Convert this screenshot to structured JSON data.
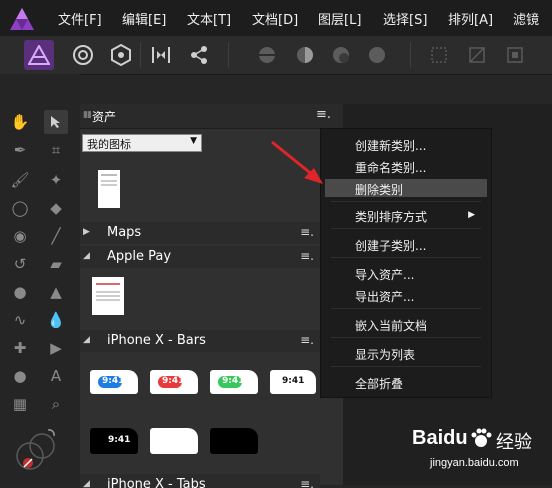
{
  "menubar": {
    "items": [
      "文件[F]",
      "编辑[E]",
      "文本[T]",
      "文档[D]",
      "图层[L]",
      "选择[S]",
      "排列[A]",
      "滤镜"
    ]
  },
  "panel": {
    "tab": "资产",
    "category_select": "我的图标",
    "sections": [
      "Maps",
      "Apple Pay",
      "iPhone X - Bars",
      "iPhone X - Tabs"
    ],
    "status_time": "9:41"
  },
  "context_menu": {
    "items": [
      "创建新类别...",
      "重命名类别...",
      "删除类别",
      "类别排序方式",
      "创建子类别...",
      "导入资产...",
      "导出资产...",
      "嵌入当前文档",
      "显示为列表",
      "全部折叠"
    ],
    "highlighted": "删除类别"
  },
  "watermark": {
    "brand": "Baidu",
    "cn": "经验",
    "url": "jingyan.baidu.com"
  },
  "colors": {
    "accent": "#5a2f7c",
    "arrow": "#e0252a",
    "bar_blue": "#1d7de0",
    "bar_red": "#e83a3a",
    "bar_green": "#38c75c"
  }
}
